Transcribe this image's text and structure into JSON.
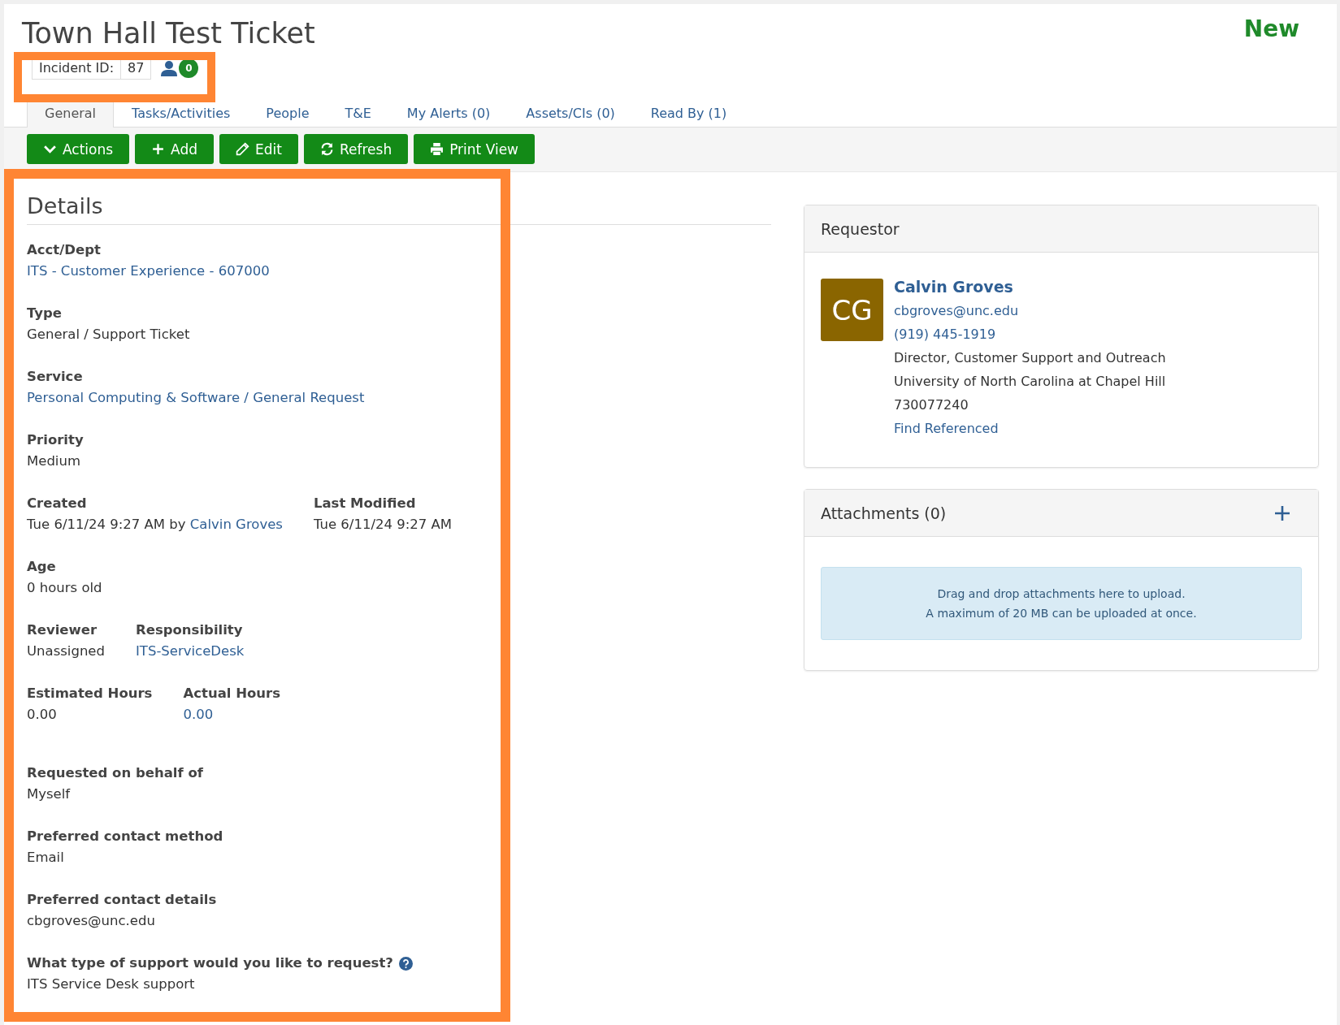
{
  "ticket": {
    "title": "Town Hall Test Ticket",
    "status": "New",
    "id_label": "Incident ID:",
    "id_value": "87",
    "contact_count": "0",
    "highlighted": true
  },
  "tabs": [
    {
      "label": "General",
      "selected": true
    },
    {
      "label": "Tasks/Activities",
      "selected": false
    },
    {
      "label": "People",
      "selected": false
    },
    {
      "label": "T&E",
      "selected": false
    },
    {
      "label": "My Alerts (0)",
      "selected": false
    },
    {
      "label": "Assets/CIs (0)",
      "selected": false
    },
    {
      "label": "Read By (1)",
      "selected": false
    }
  ],
  "toolbar": [
    {
      "label": "Actions",
      "kind": "dropdown"
    },
    {
      "label": "Add",
      "kind": "add"
    },
    {
      "label": "Edit",
      "kind": "edit"
    },
    {
      "label": "Refresh",
      "kind": "refresh"
    },
    {
      "label": "Print View",
      "kind": "print"
    }
  ],
  "details": {
    "title": "Details",
    "highlighted": true,
    "rows": [
      [
        {
          "label": "Acct/Dept",
          "value": [
            {
              "text": "ITS - Customer Experience - 607000",
              "link": true
            }
          ]
        }
      ],
      [
        {
          "label": "Type",
          "value": [
            {
              "text": "General / Support Ticket",
              "link": false
            }
          ]
        }
      ],
      [
        {
          "label": "Service",
          "value": [
            {
              "text": "Personal Computing & Software / General Request",
              "link": true
            }
          ]
        }
      ],
      [
        {
          "label": "Priority",
          "value": [
            {
              "text": "Medium",
              "link": false
            }
          ]
        }
      ],
      [
        {
          "label": "Created",
          "value": [
            {
              "text": "Tue 6/11/24 9:27 AM by ",
              "link": false
            },
            {
              "text": "Calvin Groves",
              "link": true
            }
          ]
        },
        {
          "label": "Last Modified",
          "value": [
            {
              "text": "Tue 6/11/24 9:27 AM",
              "link": false
            }
          ]
        }
      ],
      [
        {
          "label": "Age",
          "value": [
            {
              "text": "0 hours old",
              "link": false
            }
          ]
        }
      ],
      [
        {
          "label": "Reviewer",
          "value": [
            {
              "text": "Unassigned",
              "link": false
            }
          ]
        },
        {
          "label": "Responsibility",
          "value": [
            {
              "text": "ITS-ServiceDesk",
              "link": true
            }
          ]
        }
      ],
      [
        {
          "label": "Estimated Hours",
          "value": [
            {
              "text": "0.00",
              "link": false
            }
          ]
        },
        {
          "label": "Actual Hours",
          "value": [
            {
              "text": "0.00",
              "link": true
            }
          ]
        }
      ]
    ],
    "custom_rows": [
      {
        "label": "Requested on behalf of",
        "value": "Myself",
        "help": false
      },
      {
        "label": "Preferred contact method",
        "value": "Email",
        "help": false
      },
      {
        "label": "Preferred contact details",
        "value": "cbgroves@unc.edu",
        "help": false
      },
      {
        "label": "What type of support would you like to request?",
        "value": "ITS Service Desk support",
        "help": true
      }
    ]
  },
  "requestor": {
    "title": "Requestor",
    "initials": "CG",
    "name": "Calvin Groves",
    "email": "cbgroves@unc.edu",
    "phone": "(919) 445-1919",
    "job_title": "Director, Customer Support and Outreach",
    "organization": "University of North Carolina at Chapel Hill",
    "number": "730077240",
    "find_link": "Find Referenced"
  },
  "attachments": {
    "title": "Attachments (0)",
    "drop_lines": [
      "Drag and drop attachments here to upload.",
      "A maximum of 20 MB can be uploaded at once."
    ]
  }
}
